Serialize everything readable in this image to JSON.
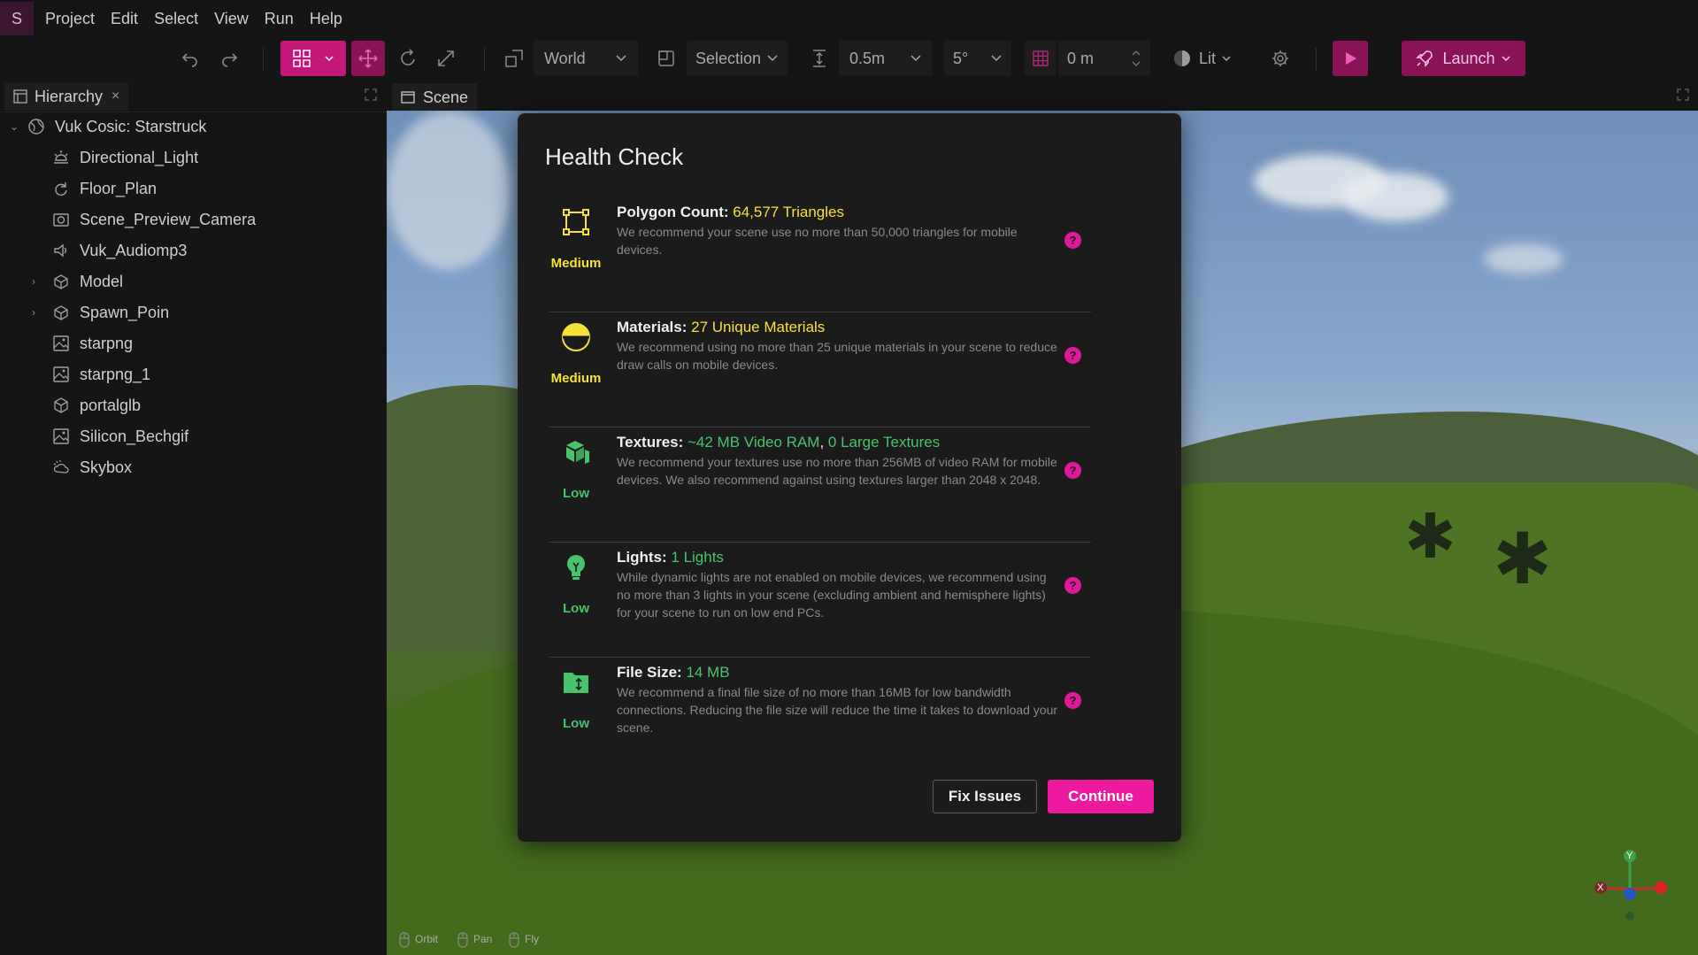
{
  "app": {
    "logo_letter": "S"
  },
  "menu": [
    "Project",
    "Edit",
    "Select",
    "View",
    "Run",
    "Help"
  ],
  "toolbar": {
    "space": "World",
    "pivot": "Selection",
    "snap_translate": "0.5m",
    "snap_rotate": "5°",
    "grid_height": "0 m",
    "render_mode": "Lit",
    "launch_label": "Launch"
  },
  "hierarchy": {
    "tab_label": "Hierarchy",
    "close": "×",
    "items": [
      {
        "label": "Vuk Cosic: Starstruck",
        "icon": "globe-icon",
        "caret": "⌄"
      },
      {
        "label": "Directional_Light",
        "icon": "sun-icon",
        "caret": ""
      },
      {
        "label": "Floor_Plan",
        "icon": "refresh-icon",
        "caret": ""
      },
      {
        "label": "Scene_Preview_Camera",
        "icon": "camera-icon",
        "caret": ""
      },
      {
        "label": "Vuk_Audiomp3",
        "icon": "speaker-icon",
        "caret": ""
      },
      {
        "label": "Model",
        "icon": "model-icon",
        "caret": "›"
      },
      {
        "label": "Spawn_Poin",
        "icon": "model-icon",
        "caret": "›"
      },
      {
        "label": "starpng",
        "icon": "image-icon",
        "caret": ""
      },
      {
        "label": "starpng_1",
        "icon": "image-icon",
        "caret": ""
      },
      {
        "label": "portalglb",
        "icon": "cube-icon",
        "caret": ""
      },
      {
        "label": "Silicon_Bechgif",
        "icon": "image-icon",
        "caret": ""
      },
      {
        "label": "Skybox",
        "icon": "cloud-sun-icon",
        "caret": ""
      }
    ]
  },
  "scene": {
    "tab_label": "Scene",
    "hints": [
      "Orbit",
      "Pan",
      "Fly"
    ],
    "gizmo": {
      "x": "X",
      "y": "Y"
    }
  },
  "health_check": {
    "title": "Health Check",
    "checks": [
      {
        "label": "Polygon Count:",
        "value": "64,577 Triangles",
        "description": "We recommend your scene use no more than 50,000 triangles for mobile devices.",
        "level": "Medium",
        "level_color": "#f6e139",
        "icon": "polygon-icon"
      },
      {
        "label": "Materials:",
        "value": "27 Unique Materials",
        "description": "We recommend using no more than 25 unique materials in your scene to reduce draw calls on mobile devices.",
        "level": "Medium",
        "level_color": "#f6e139",
        "icon": "material-icon"
      },
      {
        "label": "Textures:",
        "value": "~42 MB Video RAM",
        "value_sep": ", ",
        "value2": "0 Large Textures",
        "description": "We recommend your textures use no more than 256MB of video RAM for mobile devices. We also recommend against using textures larger than 2048 x 2048.",
        "level": "Low",
        "level_color": "#47c46b",
        "icon": "textures-icon"
      },
      {
        "label": "Lights:",
        "value": "1 Lights",
        "description": "While dynamic lights are not enabled on mobile devices, we recommend using no more than 3 lights in your scene (excluding ambient and hemisphere lights) for your scene to run on low end PCs.",
        "level": "Low",
        "level_color": "#47c46b",
        "icon": "lightbulb-icon"
      },
      {
        "label": "File Size:",
        "value": "14 MB",
        "description": "We recommend a final file size of no more than 16MB for low bandwidth connections. Reducing the file size will reduce the time it takes to download your scene.",
        "level": "Low",
        "level_color": "#47c46b",
        "icon": "file-size-icon"
      }
    ],
    "help_glyph": "?",
    "fix_label": "Fix Issues",
    "continue_label": "Continue"
  },
  "colors": {
    "accent": "#ed1aa0",
    "medium": "#f6e139",
    "low": "#47c46b"
  }
}
